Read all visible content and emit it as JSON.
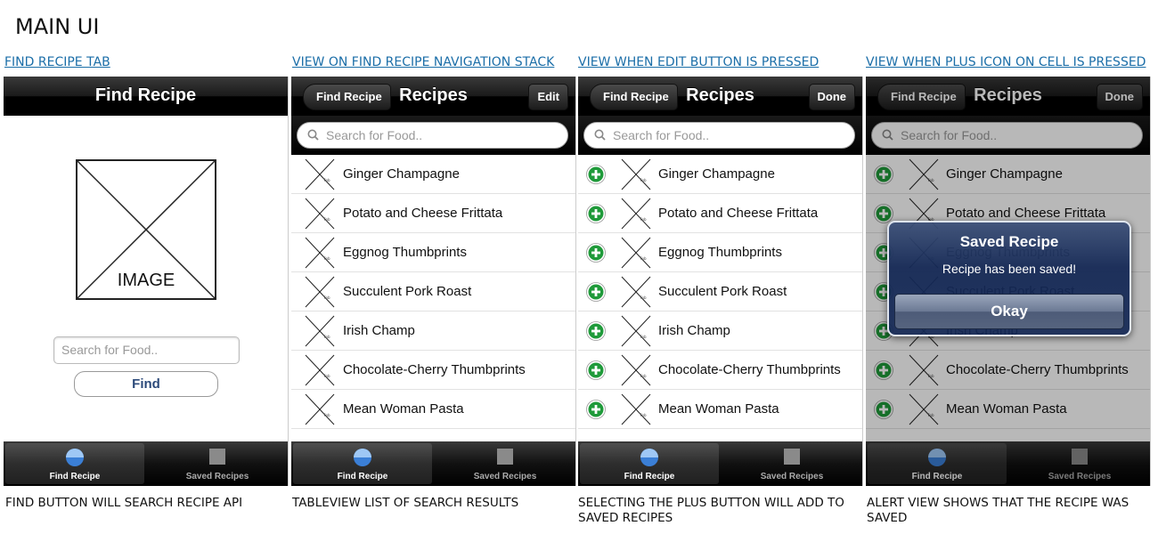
{
  "page_title": "MAIN UI",
  "panel_labels": {
    "p1": "FIND RECIPE TAB",
    "p2": "VIEW ON FIND RECIPE NAVIGATION STACK",
    "p3": "VIEW WHEN EDIT BUTTON IS PRESSED",
    "p4": "VIEW WHEN PLUS ICON ON CELL IS PRESSED"
  },
  "captions": {
    "p1": "FIND BUTTON WILL SEARCH RECIPE API",
    "p2": "TABLEVIEW LIST OF SEARCH RESULTS",
    "p3": "SELECTING THE PLUS BUTTON WILL ADD TO SAVED RECIPES",
    "p4": "ALERT VIEW SHOWS THAT THE RECIPE WAS SAVED"
  },
  "find_screen": {
    "nav_title": "Find Recipe",
    "image_placeholder": "IMAGE",
    "search_placeholder": "Search for Food..",
    "find_button": "Find"
  },
  "recipes_screen": {
    "nav_title": "Recipes",
    "back_button": "Find Recipe",
    "edit_button": "Edit",
    "done_button": "Done",
    "search_placeholder": "Search for Food..",
    "items": [
      "Ginger Champagne",
      "Potato and Cheese Frittata",
      "Eggnog Thumbprints",
      "Succulent Pork Roast",
      "Irish Champ",
      "Chocolate-Cherry Thumbprints",
      "Mean Woman Pasta"
    ]
  },
  "tabbar": {
    "tab1_label": "Find Recipe",
    "tab2_label": "Saved Recipes"
  },
  "alert": {
    "title": "Saved Recipe",
    "message": "Recipe has been saved!",
    "button": "Okay"
  },
  "colors": {
    "link_blue": "#1b6ea8",
    "plus_green": "#1f9a3a",
    "tab_active_icon": "#3b7fd6"
  }
}
